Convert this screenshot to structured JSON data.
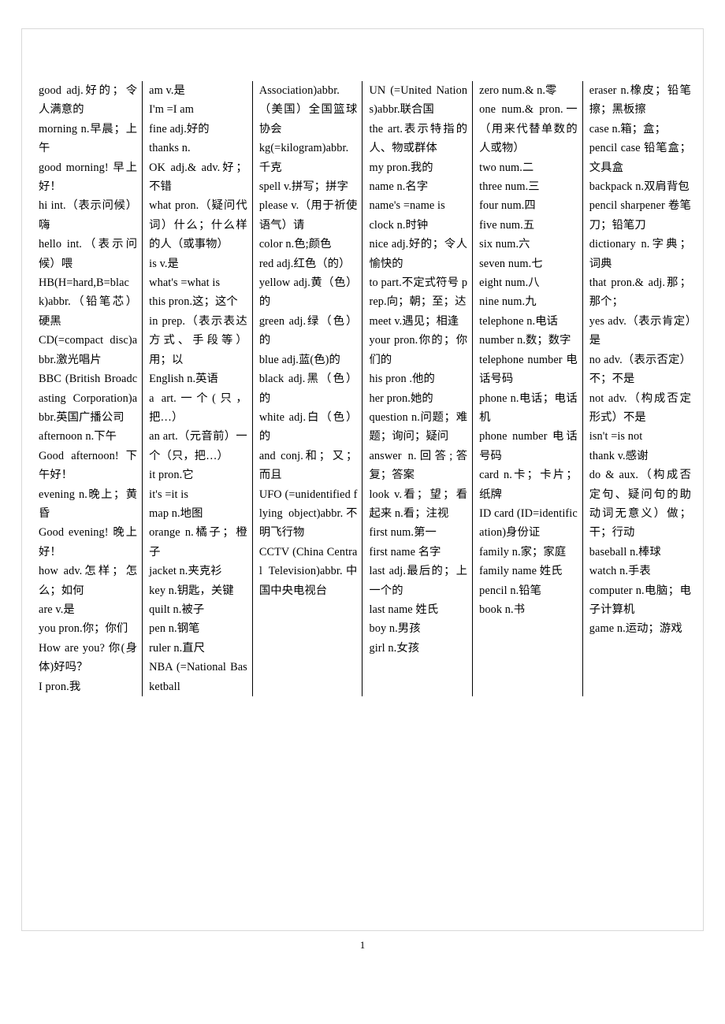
{
  "document": {
    "page_number": "1",
    "columns": [
      {
        "id": "column-1",
        "entries": [
          "good   adj.好的；令人满意的",
          "morning   n.早晨；上午",
          "good morning! 早上好！",
          "hi   int.（表示问候）嗨",
          "hello   int.（表示问候）喂",
          "HB(H=hard,B=black)abbr.（铅笔芯）硬黑",
          "CD(=compact disc)abbr.激光唱片",
          "BBC (British Broadcasting Corporation)abbr.英国广播公司",
          "afternoon   n.下午",
          "Good afternoon! 下午好！",
          "evening   n.晚上；黄昏",
          "Good evening! 晚上好！",
          "how   adv.怎样；怎么；如何",
          "are   v.是",
          "you   pron.你；你们",
          "How are you? 你(身体)好吗？",
          "I   pron.我"
        ]
      },
      {
        "id": "column-2",
        "entries": [
          "am   v.是",
          "I'm   =I am",
          "fine   adj.好的",
          "thanks   n.",
          "OK   adj.& adv.好；不错",
          "what   pron.（疑问代词）什么；什么样的人（或事物）",
          "is   v.是",
          "what's =what is",
          "this   pron.这；这个",
          "in   prep.（表示表达方式、手段等）用；以",
          "English n.英语",
          "a   art.一个(只，把…）",
          "an   art.（元音前）一个（只，把…）",
          "it   pron.它",
          "it's   =it is",
          "map   n.地图",
          "orange   n.橘子；橙子",
          "jacket   n.夹克衫",
          "key   n.钥匙，关键",
          "quilt   n.被子",
          "pen   n.钢笔",
          "ruler   n.直尺",
          "NBA (=National Basketball"
        ]
      },
      {
        "id": "column-3",
        "entries": [
          "Association)abbr.（美国）全国篮球协会",
          "kg(=kilogram)abbr.千克",
          "spell   v.拼写；拼字",
          "please   v.（用于祈使语气）请",
          "color   n.色;颜色",
          "red   adj.红色（的）",
          "yellow   adj.黄（色）的",
          "green   adj.绿（色）的",
          "blue   adj.蓝(色)的",
          "black   adj.黑（色）的",
          "white   adj.白（色）的",
          "and   conj.和；又；而且",
          "UFO (=unidentified flying object)abbr.不明飞行物",
          "CCTV (China Central Television)abbr.中国中央电视台"
        ]
      },
      {
        "id": "column-4",
        "entries": [
          "UN  (=United Nations)abbr.联合国",
          "the   art.表示特指的人、物或群体",
          "my   pron.我的",
          "name   n.名字",
          "name's =name is",
          "clock   n.时钟",
          "nice   adj.好的；令人愉快的",
          "to   part.不定式符号 prep.向；朝；至；达",
          "meet   v.遇见；相逢",
          "your   pron.你的；你们的",
          "his   pron .他的",
          "her   pron.她的",
          "question   n.问题；难题；询问；疑问",
          "answer   n.回答;答复；答案",
          "look   v.看；望；看起来 n.看；注视",
          "first   num.第一",
          "first name   名字",
          "last   adj.最后的；上一个的",
          "last name   姓氏",
          "boy   n.男孩",
          "girl   n.女孩"
        ]
      },
      {
        "id": "column-5",
        "entries": [
          "zero   num.& n.零",
          "one   num.& pron.一（用来代替单数的人或物）",
          "two   num.二",
          "three   num.三",
          "four   num.四",
          "five   num.五",
          "six   num.六",
          "seven   num.七",
          "eight   num.八",
          "nine   num.九",
          "telephone   n.电话",
          "number   n.数；数字",
          "telephone number   电话号码",
          "phone   n.电话；电话机",
          "phone number 电话号码",
          "card   n.卡；卡片；纸牌",
          "ID card (ID=identification)身份证",
          "family   n.家；家庭",
          "family name   姓氏",
          "pencil   n.铅笔",
          "book   n.书"
        ]
      },
      {
        "id": "column-6",
        "entries": [
          "eraser   n.橡皮；铅笔擦；黑板擦",
          "case   n.箱；盒；",
          "pencil case   铅笔盒；文具盒",
          "backpack   n.双肩背包",
          "pencil sharpener   卷笔刀；铅笔刀",
          "dictionary   n.字典；词典",
          "that   pron.& adj.那；那个；",
          "yes   adv.（表示肯定）是",
          "no   adv.（表示否定）不；不是",
          "not   adv.（构成否定形式）不是",
          "isn't   =is not",
          "thank   v.感谢",
          "do   & aux.（构成否定句、疑问句的助动词无意义）做；干；行动",
          "baseball   n.棒球",
          "watch   n.手表",
          "computer   n.电脑；电子计算机",
          "game   n.运动；游戏"
        ]
      }
    ]
  }
}
